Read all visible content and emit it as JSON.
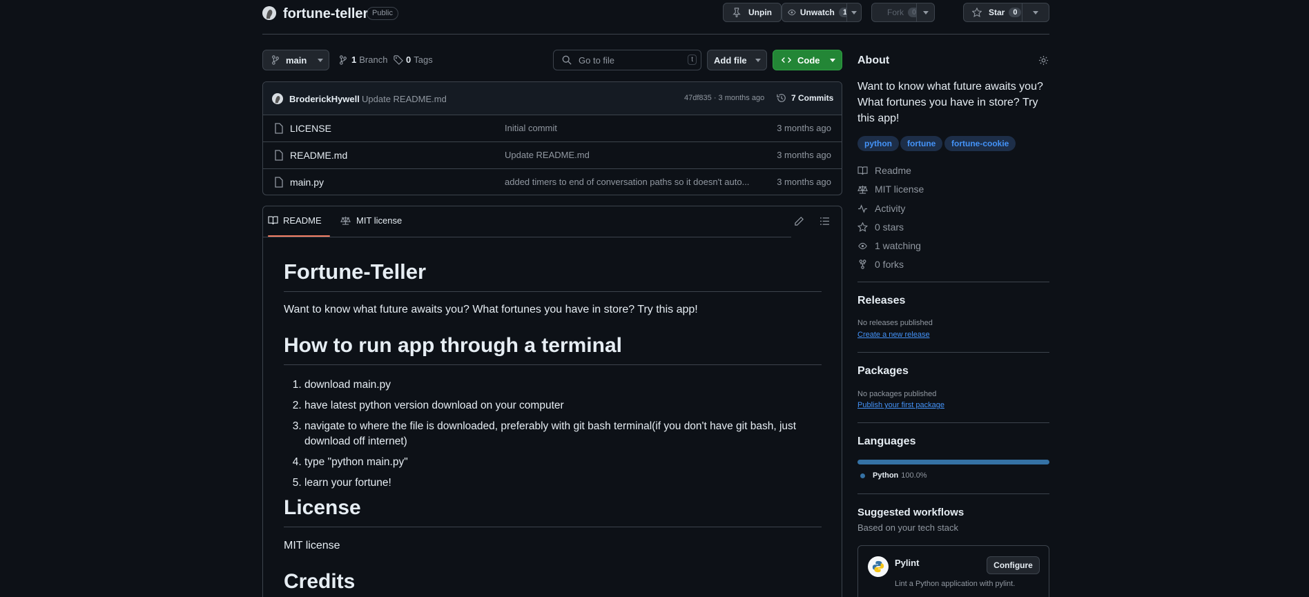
{
  "repo": {
    "name": "fortune-teller",
    "visibility": "Public"
  },
  "actions": {
    "unpin": "Unpin",
    "unwatch": "Unwatch",
    "unwatch_count": "1",
    "fork": "Fork",
    "fork_count": "0",
    "star": "Star",
    "star_count": "0"
  },
  "branchbar": {
    "branch": "main",
    "branches_count": "1",
    "branches_label": "Branch",
    "tags_count": "0",
    "tags_label": "Tags",
    "go_to_file": "Go to file",
    "shortcut": "t",
    "add_file": "Add file",
    "code": "Code"
  },
  "commit": {
    "author": "BroderickHywell",
    "message": "Update README.md",
    "meta": "47df835 · 3 months ago",
    "commits": "7 Commits"
  },
  "files": [
    {
      "name": "LICENSE",
      "message": "Initial commit",
      "time": "3 months ago"
    },
    {
      "name": "README.md",
      "message": "Update README.md",
      "time": "3 months ago"
    },
    {
      "name": "main.py",
      "message": "added timers to end of conversation paths so it doesn't auto...",
      "time": "3 months ago"
    }
  ],
  "readme_tabs": {
    "readme": "README",
    "license": "MIT license"
  },
  "readme": {
    "h1": "Fortune-Teller",
    "intro": "Want to know what future awaits you? What fortunes you have in store? Try this app!",
    "h2_run": "How to run app through a terminal",
    "steps": [
      "download main.py",
      "have latest python version download on your computer",
      "navigate to where the file is downloaded, preferably with git bash terminal(if you don't have git bash, just download off internet)",
      "type \"python main.py\"",
      "learn your fortune!"
    ],
    "h2_license": "License",
    "license_text": "MIT license",
    "h2_credits": "Credits"
  },
  "about": {
    "heading": "About",
    "description": "Want to know what future awaits you? What fortunes you have in store? Try this app!",
    "topics": [
      "python",
      "fortune",
      "fortune-cookie"
    ],
    "links": {
      "readme": "Readme",
      "license": "MIT license",
      "activity": "Activity",
      "stars": "0 stars",
      "watching": "1 watching",
      "forks": "0 forks"
    }
  },
  "releases": {
    "heading": "Releases",
    "empty": "No releases published",
    "link": "Create a new release"
  },
  "packages": {
    "heading": "Packages",
    "empty": "No packages published",
    "link": "Publish your first package"
  },
  "languages": {
    "heading": "Languages",
    "name": "Python",
    "percent": "100.0%",
    "color": "#3572A5",
    "share": 1.0
  },
  "workflows": {
    "heading": "Suggested workflows",
    "sub": "Based on your tech stack",
    "name": "Pylint",
    "button": "Configure",
    "desc": "Lint a Python application with pylint."
  },
  "colors": {
    "accent_green": "#238636",
    "link": "#4493f8",
    "tab_underline": "#f78166"
  }
}
